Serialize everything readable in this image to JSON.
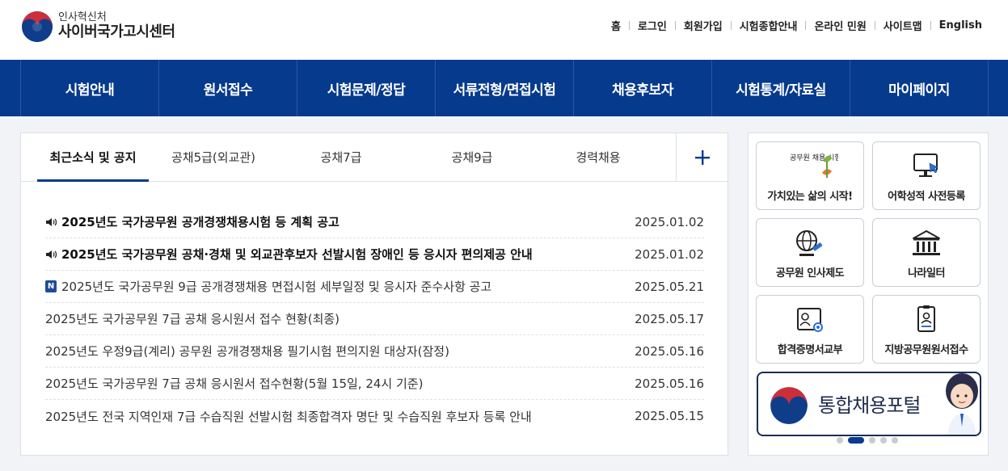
{
  "header": {
    "logo_sub": "인사혁신처",
    "logo_main": "사이버국가고시센터",
    "util_links": [
      "홈",
      "로그인",
      "회원가입",
      "시험종합안내",
      "온라인 민원",
      "사이트맵",
      "English"
    ]
  },
  "nav": {
    "items": [
      "시험안내",
      "원서접수",
      "시험문제/정답",
      "서류전형/면접시험",
      "채용후보자",
      "시험통계/자료실",
      "마이페이지"
    ]
  },
  "notice": {
    "tabs": [
      "최근소식 및 공지",
      "공채5급(외교관)",
      "공채7급",
      "공채9급",
      "경력채용"
    ],
    "active_tab": 0,
    "more_label": "+",
    "items": [
      {
        "title": "2025년도 국가공무원 공개경쟁채용시험 등 계획 공고",
        "date": "2025.01.02",
        "marker": "speaker"
      },
      {
        "title": "2025년도 국가공무원 공채·경채 및 외교관후보자 선발시험 장애인 등 응시자 편의제공 안내",
        "date": "2025.01.02",
        "marker": "speaker"
      },
      {
        "title": "2025년도 국가공무원 9급 공개경쟁채용 면접시험 세부일정 및 응시자 준수사항 공고",
        "date": "2025.05.21",
        "marker": "new",
        "badge": "N"
      },
      {
        "title": "2025년도 국가공무원 7급 공채 응시원서 접수 현황(최종)",
        "date": "2025.05.17",
        "marker": ""
      },
      {
        "title": "2025년도 우정9급(계리) 공무원 공개경쟁채용 필기시험 편의지원 대상자(잠정)",
        "date": "2025.05.16",
        "marker": ""
      },
      {
        "title": "2025년도 국가공무원 7급 공채 응시원서 접수현황(5월 15일, 24시 기준)",
        "date": "2025.05.16",
        "marker": ""
      },
      {
        "title": "2025년도 전국 지역인재 7급 수습직원 선발시험 최종합격자 명단 및 수습직원 후보자 등록 안내",
        "date": "2025.05.15",
        "marker": ""
      }
    ]
  },
  "quick_links": [
    {
      "label": "가치있는 삶의 시작!",
      "icon": "gongmuwon-slogan-icon",
      "logo_text": "공무원 채용 시험"
    },
    {
      "label": "어학성적 사전등록",
      "icon": "monitor-cursor-icon"
    },
    {
      "label": "공무원 인사제도",
      "icon": "globe-gavel-icon"
    },
    {
      "label": "나라일터",
      "icon": "government-building-icon"
    },
    {
      "label": "합격증명서교부",
      "icon": "certificate-icon"
    },
    {
      "label": "지방공무원원서접수",
      "icon": "id-document-icon"
    }
  ],
  "banner": {
    "text": "통합채용포털",
    "slides": 5,
    "active_slide": 1
  },
  "colors": {
    "brand_navy": "#063a8c",
    "logo_red": "#cd2e3a",
    "logo_blue": "#0f3d8a"
  }
}
